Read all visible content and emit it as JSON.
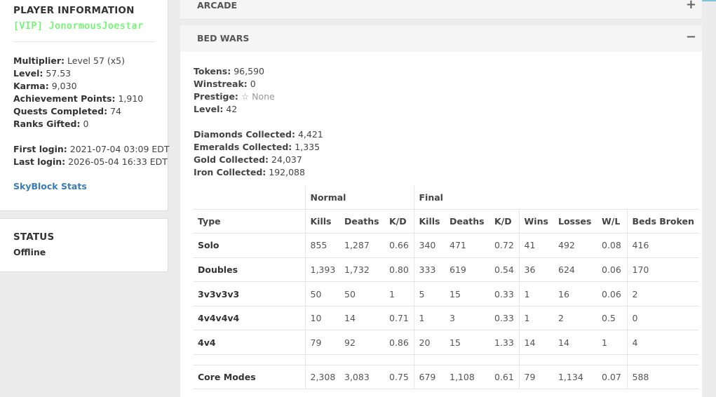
{
  "player": {
    "heading": "PLAYER INFORMATION",
    "name": "[VIP] JonormousJoestar",
    "name_color": "#55ff55",
    "multiplier_label": "Multiplier:",
    "multiplier": "Level 57 (x5)",
    "level_label": "Level:",
    "level": "57.53",
    "karma_label": "Karma:",
    "karma": "9,030",
    "ap_label": "Achievement Points:",
    "ap": "1,910",
    "quests_label": "Quests Completed:",
    "quests": "74",
    "ranks_label": "Ranks Gifted:",
    "ranks": "0",
    "first_login_label": "First login:",
    "first_login": "2021-07-04 03:09 EDT",
    "last_login_label": "Last login:",
    "last_login": "2026-05-04 16:33 EDT",
    "skyblock_link": "SkyBlock Stats"
  },
  "status": {
    "heading": "STATUS",
    "value": "Offline"
  },
  "arcade": {
    "title": "ARCADE",
    "toggle": "+"
  },
  "bedwars": {
    "title": "BED WARS",
    "toggle": "−",
    "tokens_label": "Tokens:",
    "tokens": "96,590",
    "winstreak_label": "Winstreak:",
    "winstreak": "0",
    "prestige_label": "Prestige:",
    "prestige": "☆ None",
    "level_label": "Level:",
    "level": "42",
    "diamonds_label": "Diamonds Collected:",
    "diamonds": "4,421",
    "emeralds_label": "Emeralds Collected:",
    "emeralds": "1,335",
    "gold_label": "Gold Collected:",
    "gold": "24,037",
    "iron_label": "Iron Collected:",
    "iron": "192,088",
    "table": {
      "group_normal": "Normal",
      "group_final": "Final",
      "headers": [
        "Type",
        "Kills",
        "Deaths",
        "K/D",
        "Kills",
        "Deaths",
        "K/D",
        "Wins",
        "Losses",
        "W/L",
        "Beds Broken"
      ],
      "rows": [
        [
          "Solo",
          "855",
          "1,287",
          "0.66",
          "340",
          "471",
          "0.72",
          "41",
          "492",
          "0.08",
          "416"
        ],
        [
          "Doubles",
          "1,393",
          "1,732",
          "0.80",
          "333",
          "619",
          "0.54",
          "36",
          "624",
          "0.06",
          "170"
        ],
        [
          "3v3v3v3",
          "50",
          "50",
          "1",
          "5",
          "15",
          "0.33",
          "1",
          "16",
          "0.06",
          "2"
        ],
        [
          "4v4v4v4",
          "10",
          "14",
          "0.71",
          "1",
          "3",
          "0.33",
          "1",
          "2",
          "0.5",
          "0"
        ],
        [
          "4v4",
          "79",
          "92",
          "0.86",
          "20",
          "15",
          "1.33",
          "14",
          "14",
          "1",
          "4"
        ]
      ],
      "core": [
        "Core Modes",
        "2,308",
        "3,083",
        "0.75",
        "679",
        "1,108",
        "0.61",
        "79",
        "1,134",
        "0.07",
        "588"
      ]
    }
  }
}
